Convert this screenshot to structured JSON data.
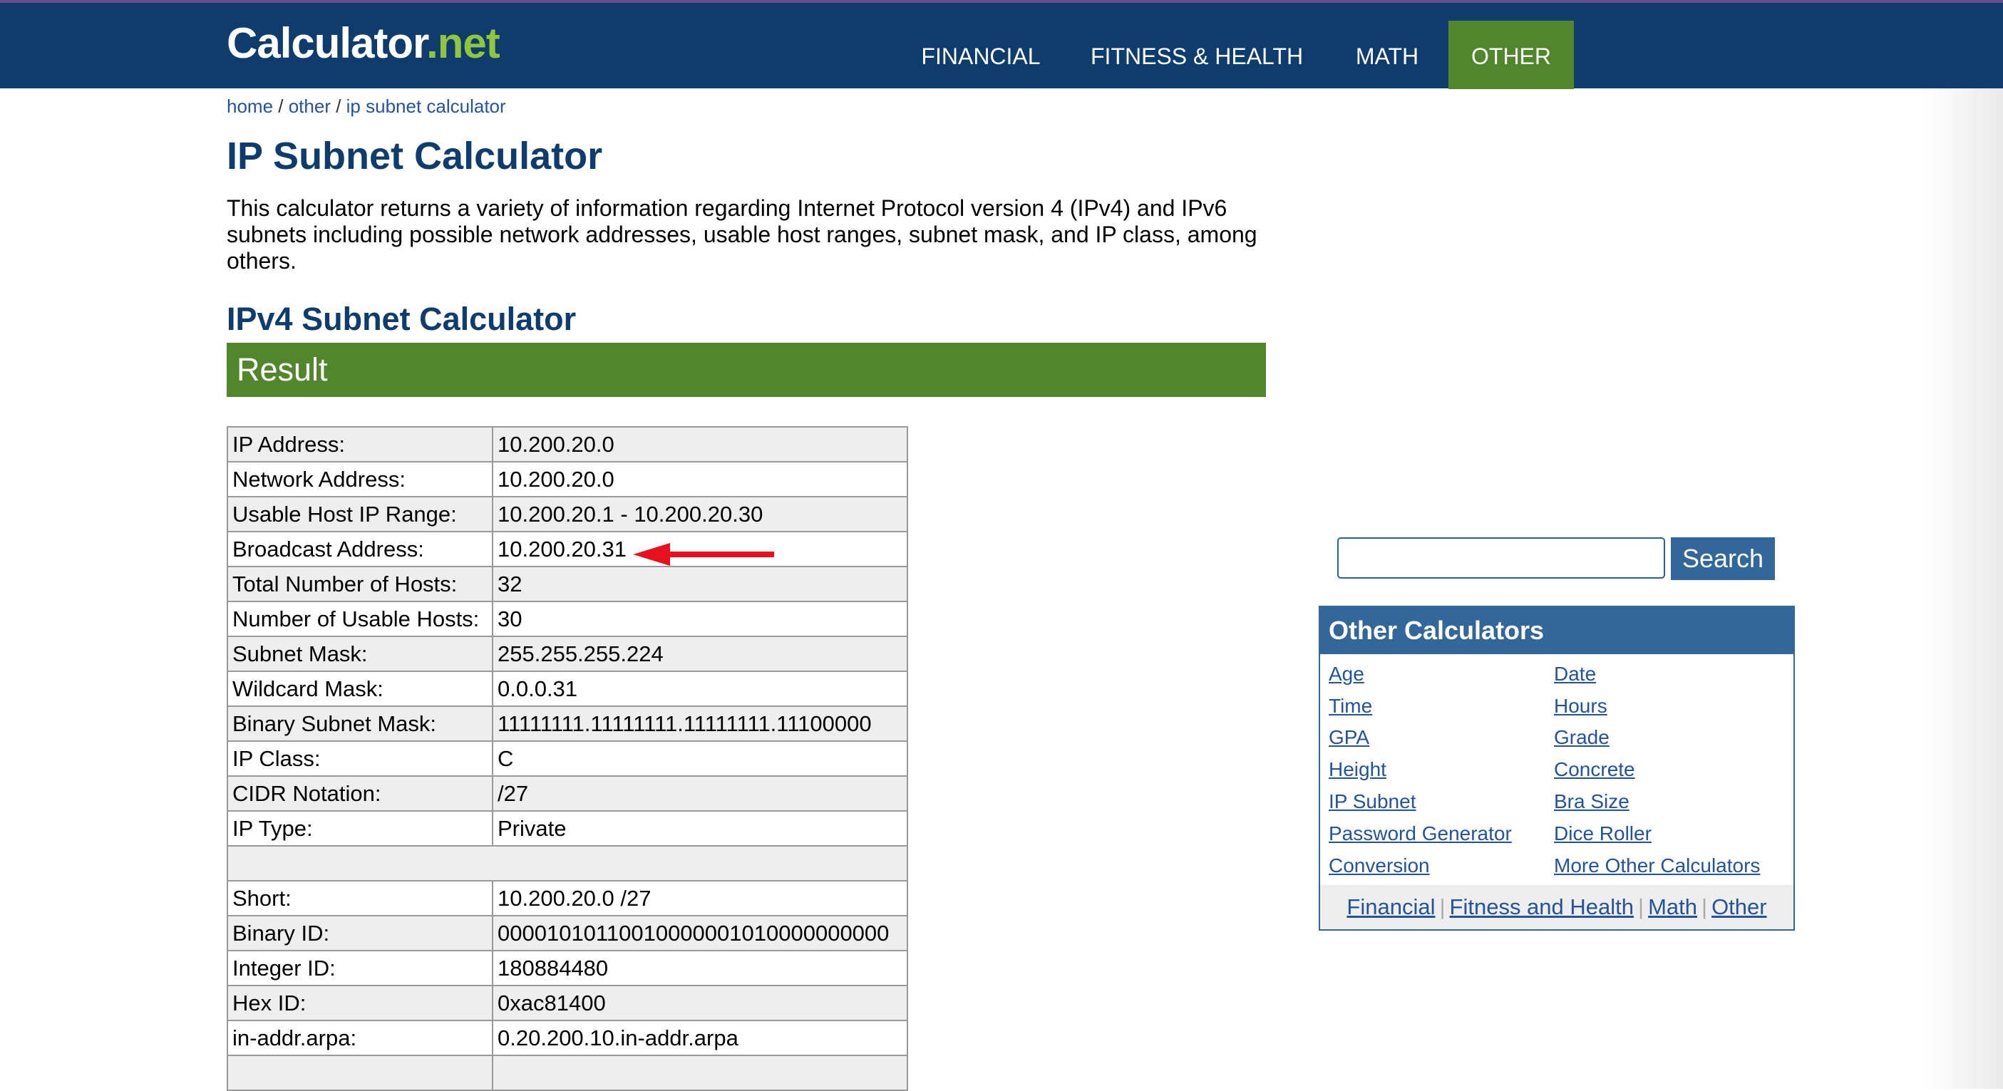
{
  "header": {
    "logo_main": "Calculator",
    "logo_dot": ".",
    "logo_tld": "net",
    "nav": [
      "FINANCIAL",
      "FITNESS & HEALTH",
      "MATH",
      "OTHER"
    ]
  },
  "breadcrumb": {
    "home": "home",
    "sep1": " / ",
    "other": "other",
    "sep2": " / ",
    "current": "ip subnet calculator"
  },
  "page_title": "IP Subnet Calculator",
  "intro": "This calculator returns a variety of information regarding Internet Protocol version 4 (IPv4) and IPv6 subnets including possible network addresses, usable host ranges, subnet mask, and IP class, among others.",
  "section_title": "IPv4 Subnet Calculator",
  "result_label": "Result",
  "results": [
    {
      "label": "IP Address:",
      "value": "10.200.20.0"
    },
    {
      "label": "Network Address:",
      "value": "10.200.20.0"
    },
    {
      "label": "Usable Host IP Range:",
      "value": "10.200.20.1 - 10.200.20.30"
    },
    {
      "label": "Broadcast Address:",
      "value": "10.200.20.31"
    },
    {
      "label": "Total Number of Hosts:",
      "value": "32"
    },
    {
      "label": "Number of Usable Hosts:",
      "value": "30"
    },
    {
      "label": "Subnet Mask:",
      "value": "255.255.255.224"
    },
    {
      "label": "Wildcard Mask:",
      "value": "0.0.0.31"
    },
    {
      "label": "Binary Subnet Mask:",
      "value": "11111111.11111111.11111111.11100000"
    },
    {
      "label": "IP Class:",
      "value": "C"
    },
    {
      "label": "CIDR Notation:",
      "value": "/27"
    },
    {
      "label": "IP Type:",
      "value": "Private"
    }
  ],
  "results2": [
    {
      "label": "Short:",
      "value": "10.200.20.0 /27"
    },
    {
      "label": "Binary ID:",
      "value": "00001010110010000001010000000000"
    },
    {
      "label": "Integer ID:",
      "value": "180884480"
    },
    {
      "label": "Hex ID:",
      "value": "0xac81400"
    },
    {
      "label": "in-addr.arpa:",
      "value": "0.20.200.10.in-addr.arpa"
    }
  ],
  "search": {
    "button_label": "Search",
    "value": ""
  },
  "other_calculators": {
    "title": "Other Calculators",
    "left": [
      "Age",
      "Time",
      "GPA",
      "Height",
      "IP Subnet",
      "Password Generator",
      "Conversion"
    ],
    "right": [
      "Date",
      "Hours",
      "Grade",
      "Concrete",
      "Bra Size",
      "Dice Roller",
      "More Other Calculators"
    ],
    "footer": [
      "Financial",
      "Fitness and Health",
      "Math",
      "Other"
    ],
    "footer_sep": "|"
  },
  "colors": {
    "header_bg": "#0e3d6d",
    "accent_green": "#51862d",
    "link_blue": "#245398",
    "box_blue": "#336699",
    "arrow_red": "#e8101c"
  },
  "icons": [
    "red-arrow-icon"
  ]
}
